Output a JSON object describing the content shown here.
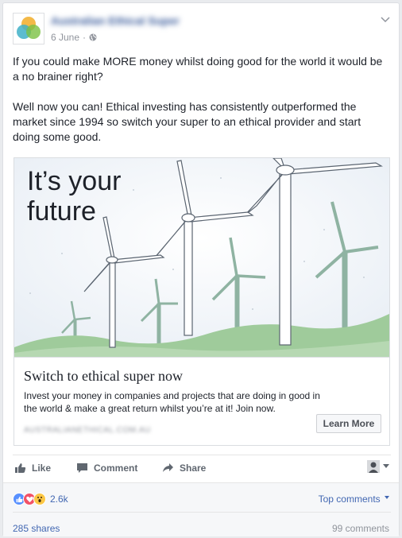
{
  "post": {
    "page_name": "Australian Ethical Super",
    "date": "6 June",
    "separator": "·",
    "paragraphs": [
      "If you could make MORE money whilst doing good for the world it would be a no brainer right?",
      "Well now you can! Ethical investing has consistently outperformed the market since 1994 so switch your super to an ethical provider and start doing some good."
    ]
  },
  "link": {
    "hero_line1": "It’s your",
    "hero_line2": "future",
    "title": "Switch to ethical super now",
    "description": "Invest your money in companies and projects that are doing in good in the world & make a great return whilst you’re at it! Join now.",
    "domain": "AUSTRALIANETHICAL.COM.AU",
    "cta": "Learn More"
  },
  "actions": {
    "like": "Like",
    "comment": "Comment",
    "share": "Share"
  },
  "footer": {
    "reaction_count": "2.6k",
    "top_comments": "Top comments",
    "shares": "285 shares",
    "comments": "99 comments"
  },
  "colors": {
    "link_blue": "#4267b2",
    "like_blue": "#5890ff",
    "love_red": "#f25268",
    "wow_yellow": "#fcc745",
    "hill_green": "#9fcb9b"
  }
}
